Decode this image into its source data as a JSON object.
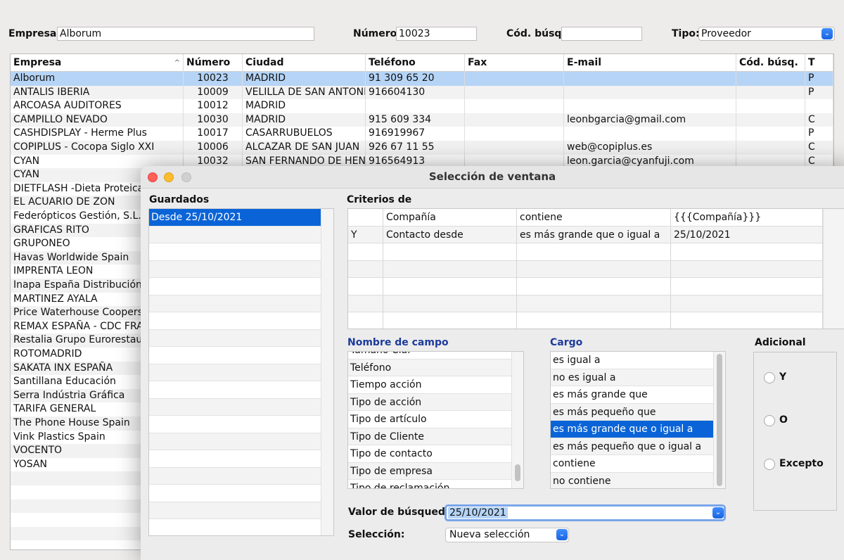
{
  "filters": {
    "empresa_label": "Empresa:",
    "empresa_value": "Alborum",
    "numero_label": "Número:",
    "numero_value": "10023",
    "codbusq_label": "Cód. búsq.:",
    "codbusq_value": "",
    "tipo_label": "Tipo:",
    "tipo_value": "Proveedor"
  },
  "table": {
    "headers": [
      "Empresa",
      "Número",
      "Ciudad",
      "Teléfono",
      "Fax",
      "E-mail",
      "Cód. búsq.",
      "T"
    ],
    "sort_indicator": "^",
    "rows": [
      [
        "Alborum",
        "10023",
        "MADRID",
        "91 309 65 20",
        "",
        "",
        "",
        "P"
      ],
      [
        "ANTALIS IBERIA",
        "10009",
        "VELILLA DE SAN ANTONIC",
        "916604130",
        "",
        "",
        "",
        "P"
      ],
      [
        "ARCOASA AUDITORES",
        "10012",
        "MADRID",
        "",
        "",
        "",
        "",
        ""
      ],
      [
        "CAMPILLO NEVADO",
        "10030",
        "MADRID",
        "915 609 334",
        "",
        "leonbgarcia@gmail.com",
        "",
        "C"
      ],
      [
        "CASHDISPLAY - Herme Plus",
        "10017",
        "CASARRUBUELOS",
        "916919967",
        "",
        "",
        "",
        "P"
      ],
      [
        "COPIPLUS - Cocopa Siglo XXI",
        "10006",
        "ALCAZAR DE SAN JUAN",
        "926 67 11 55",
        "",
        "web@copiplus.es",
        "",
        "C"
      ],
      [
        "CYAN",
        "10032",
        "SAN FERNANDO DE HENA",
        "916564913",
        "",
        "leon.garcia@cyanfuji.com",
        "",
        "C"
      ],
      [
        "CYAN",
        "",
        "",
        "",
        "",
        "",
        "",
        ""
      ],
      [
        "DIETFLASH -Dieta Proteica",
        "",
        "",
        "",
        "",
        "",
        "",
        ""
      ],
      [
        "EL ACUARIO DE ZON",
        "",
        "",
        "",
        "",
        "",
        "",
        ""
      ],
      [
        "Federópticos Gestión, S.L.",
        "",
        "",
        "",
        "",
        "",
        "",
        ""
      ],
      [
        "GRAFICAS RITO",
        "",
        "",
        "",
        "",
        "",
        "",
        ""
      ],
      [
        "GRUPONEO",
        "",
        "",
        "",
        "",
        "",
        "",
        ""
      ],
      [
        "Havas Worldwide Spain",
        "",
        "",
        "",
        "",
        "",
        "",
        ""
      ],
      [
        "IMPRENTA LEON",
        "",
        "",
        "",
        "",
        "",
        "",
        ""
      ],
      [
        "Inapa España Distribución de",
        "",
        "",
        "",
        "",
        "",
        "",
        ""
      ],
      [
        "MARTINEZ AYALA",
        "",
        "",
        "",
        "",
        "",
        "",
        ""
      ],
      [
        "Price Waterhouse Coopers",
        "",
        "",
        "",
        "",
        "",
        "",
        ""
      ],
      [
        "REMAX ESPAÑA - CDC FRAN",
        "",
        "",
        "",
        "",
        "",
        "",
        ""
      ],
      [
        "Restalia Grupo Eurorestaurac",
        "",
        "",
        "",
        "",
        "",
        "",
        ""
      ],
      [
        "ROTOMADRID",
        "",
        "",
        "",
        "",
        "",
        "",
        ""
      ],
      [
        "SAKATA INX ESPAÑA",
        "",
        "",
        "",
        "",
        "",
        "",
        ""
      ],
      [
        "Santillana Educación",
        "",
        "",
        "",
        "",
        "",
        "",
        ""
      ],
      [
        "Serra Indústria Gráfica",
        "",
        "",
        "",
        "",
        "",
        "",
        ""
      ],
      [
        "TARIFA GENERAL",
        "",
        "",
        "",
        "",
        "",
        "",
        ""
      ],
      [
        "The Phone House Spain",
        "",
        "",
        "",
        "",
        "",
        "",
        ""
      ],
      [
        "Vink Plastics Spain",
        "",
        "",
        "",
        "",
        "",
        "",
        ""
      ],
      [
        "VOCENTO",
        "",
        "",
        "",
        "",
        "",
        "",
        ""
      ],
      [
        "YOSAN",
        "",
        "",
        "",
        "",
        "",
        "",
        ""
      ]
    ]
  },
  "dialog": {
    "title": "Selección de ventana",
    "guardados_label": "Guardados",
    "guardados_items": [
      "Desde 25/10/2021"
    ],
    "criterios_label": "Criterios de",
    "criterios_rows": [
      [
        "",
        "Compañía",
        "contiene",
        "{{{Compañía}}}"
      ],
      [
        "Y",
        "Contacto desde",
        "es más grande que o igual a",
        "25/10/2021"
      ]
    ],
    "nombre_campo_label": "Nombre de campo",
    "nombre_campo_items": [
      "Tamaño Cía.",
      "Teléfono",
      "Tiempo acción",
      "Tipo de acción",
      "Tipo de artículo",
      "Tipo de Cliente",
      "Tipo de contacto",
      "Tipo de empresa",
      "Tipo de reclamación"
    ],
    "cargo_label": "Cargo",
    "cargo_items": [
      "es igual a",
      "no es igual a",
      "es más grande que",
      "es más pequeño que",
      "es más grande que o igual a",
      "es más pequeño que o igual a",
      "contiene",
      "no contiene"
    ],
    "cargo_selected": "es más grande que o igual a",
    "adicional_label": "Adicional",
    "adicional_options": [
      "Y",
      "O",
      "Excepto"
    ],
    "valor_label": "Valor de búsqueda:",
    "valor_value": "25/10/2021",
    "seleccion_label": "Selección:",
    "seleccion_value": "Nueva selección"
  },
  "colors": {
    "selection_blue": "#0a64d8",
    "row_highlight": "#b5d4f6",
    "section_blue": "#1d3b9c",
    "close": "#fe5f57",
    "minimize": "#febc2e",
    "zoom_disabled": "#d0d0d0"
  }
}
